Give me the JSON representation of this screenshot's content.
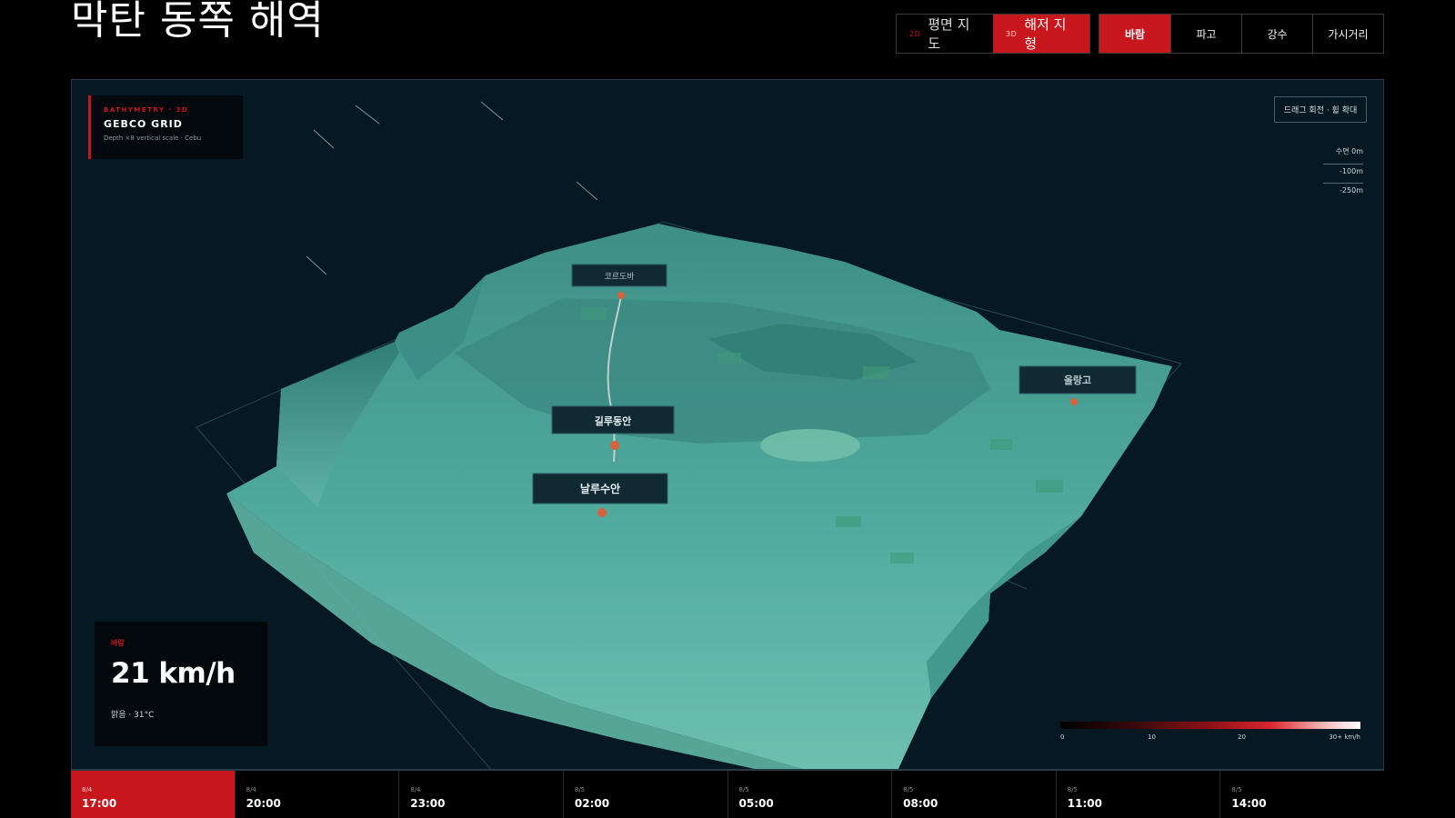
{
  "page": {
    "title": "막탄 동쪽 해역"
  },
  "view_toggle": [
    {
      "tag": "2D",
      "label": "평면 지도",
      "active": false
    },
    {
      "tag": "3D",
      "label": "해저 지형",
      "active": true
    }
  ],
  "layer_tabs": [
    {
      "label": "바람",
      "active": true
    },
    {
      "label": "파고",
      "active": false
    },
    {
      "label": "강수",
      "active": false
    },
    {
      "label": "가시거리",
      "active": false
    }
  ],
  "map": {
    "source_card": {
      "kicker": "BATHYMETRY · 3D",
      "title": "GEBCO GRID",
      "subtitle": "Depth ×8 vertical scale · Cebu"
    },
    "hint": "드래그 회전 · 휠 확대",
    "depth_legend": [
      "수면 0m",
      "-100m",
      "-250m"
    ],
    "markers": [
      {
        "label": "코르도바"
      },
      {
        "label": "길루동안"
      },
      {
        "label": "날루수안"
      },
      {
        "label": "올랑고"
      }
    ],
    "colors": {
      "terrain": "#4fa89c",
      "marker": "#d9623a",
      "accent": "#c8161d"
    }
  },
  "wind_card": {
    "kicker": "바람",
    "value": "21 km/h",
    "condition": "맑음 · 31°C"
  },
  "scale": {
    "ticks": [
      "0",
      "10",
      "20",
      "30+ km/h"
    ]
  },
  "timeline": [
    {
      "date": "8/4",
      "time": "17:00",
      "active": true
    },
    {
      "date": "8/4",
      "time": "20:00",
      "active": false
    },
    {
      "date": "8/4",
      "time": "23:00",
      "active": false
    },
    {
      "date": "8/5",
      "time": "02:00",
      "active": false
    },
    {
      "date": "8/5",
      "time": "05:00",
      "active": false
    },
    {
      "date": "8/5",
      "time": "08:00",
      "active": false
    },
    {
      "date": "8/5",
      "time": "11:00",
      "active": false
    },
    {
      "date": "8/5",
      "time": "14:00",
      "active": false
    }
  ]
}
